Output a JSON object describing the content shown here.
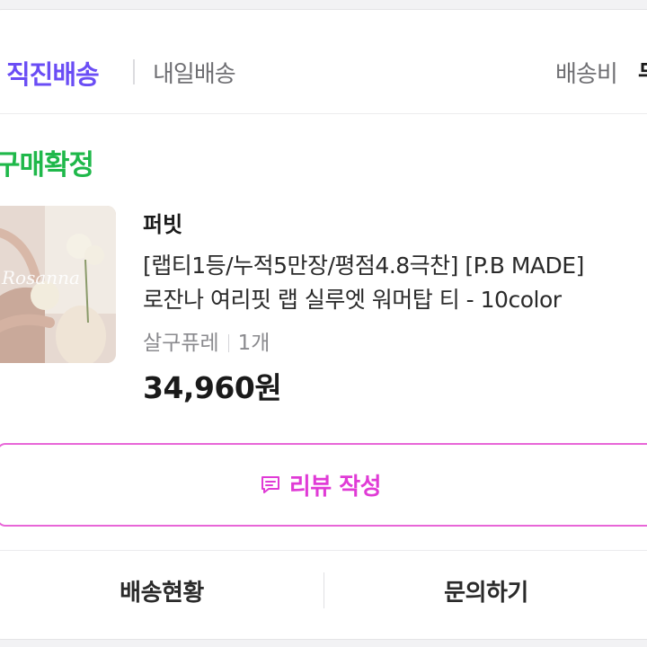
{
  "shipping": {
    "direct_label": "직진배송",
    "tomorrow_label": "내일배송",
    "fee_label": "배송비",
    "fee_value": "무"
  },
  "order": {
    "status": "구매확정",
    "status_color": "#1fb84a"
  },
  "product": {
    "seller": "퍼빗",
    "title_line1": "[랩티1등/누적5만장/평점4.8극찬] [P.B MADE]",
    "title_line2": "로잔나 여리핏 랩 실루엣 워머탑 티 - 10color",
    "option": "살구퓨레",
    "quantity": "1개",
    "price": "34,960원",
    "thumbnail_text": "Rosanna"
  },
  "actions": {
    "review_label": "리뷰 작성",
    "review_icon": "message-edit-icon",
    "review_color": "#e03bd6",
    "track_label": "배송현황",
    "inquiry_label": "문의하기"
  },
  "colors": {
    "accent_purple": "#6a4df5",
    "review_border": "#e866d8"
  }
}
